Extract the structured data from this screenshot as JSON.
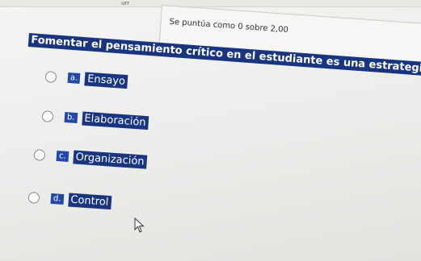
{
  "header": {
    "stub_text": "urr"
  },
  "info": {
    "score_text": "Se puntúa como 0 sobre 2,00"
  },
  "question": {
    "text": "Fomentar el pensamiento crítico en el estudiante es una estrategia de:"
  },
  "options": [
    {
      "letter": "a.",
      "label": "Ensayo"
    },
    {
      "letter": "b.",
      "label": "Elaboración"
    },
    {
      "letter": "c.",
      "label": "Organización"
    },
    {
      "letter": "d.",
      "label": "Control"
    }
  ],
  "cursor": {
    "icon": "mouse-pointer-icon"
  }
}
